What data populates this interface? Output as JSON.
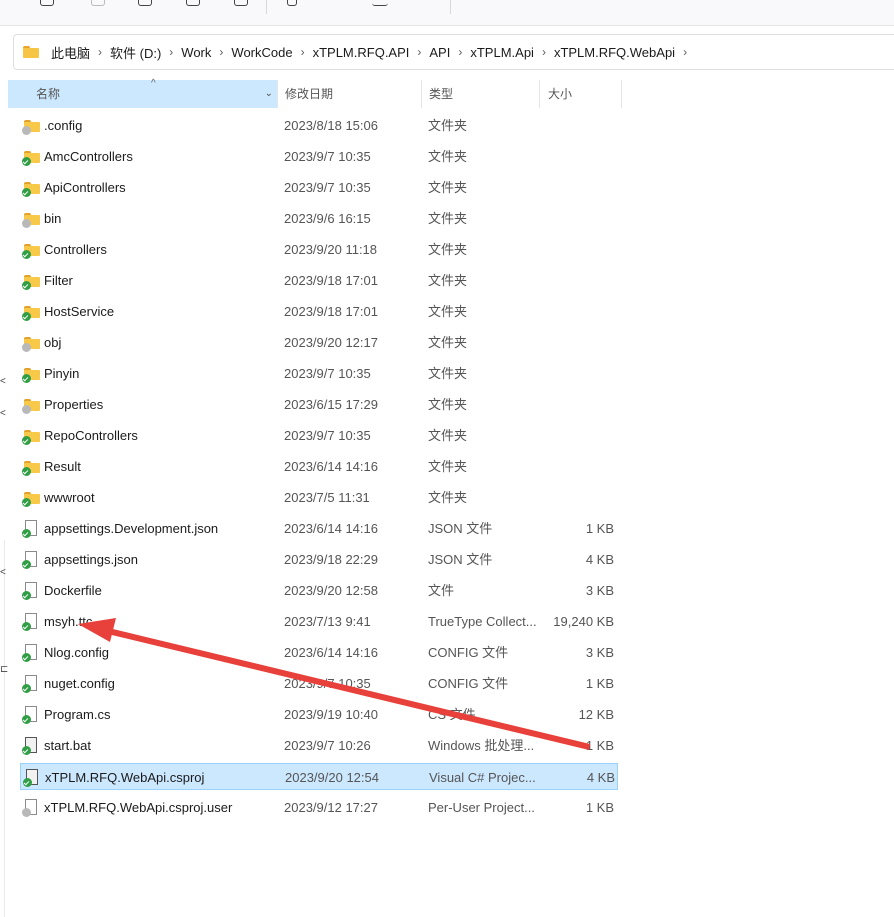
{
  "address": {
    "folder_icon": "folder-icon",
    "crumbs": [
      "此电脑",
      "软件 (D:)",
      "Work",
      "WorkCode",
      "xTPLM.RFQ.API",
      "API",
      "xTPLM.Api",
      "xTPLM.RFQ.WebApi"
    ],
    "separator": "›"
  },
  "columns": {
    "name": "名称",
    "date": "修改日期",
    "type": "类型",
    "size": "大小"
  },
  "files": [
    {
      "name": ".config",
      "date": "2023/8/18 15:06",
      "type": "文件夹",
      "size": "",
      "icon": "folder",
      "sync": "grey"
    },
    {
      "name": "AmcControllers",
      "date": "2023/9/7 10:35",
      "type": "文件夹",
      "size": "",
      "icon": "folder",
      "sync": "green"
    },
    {
      "name": "ApiControllers",
      "date": "2023/9/7 10:35",
      "type": "文件夹",
      "size": "",
      "icon": "folder",
      "sync": "green"
    },
    {
      "name": "bin",
      "date": "2023/9/6 16:15",
      "type": "文件夹",
      "size": "",
      "icon": "folder",
      "sync": "grey"
    },
    {
      "name": "Controllers",
      "date": "2023/9/20 11:18",
      "type": "文件夹",
      "size": "",
      "icon": "folder",
      "sync": "green"
    },
    {
      "name": "Filter",
      "date": "2023/9/18 17:01",
      "type": "文件夹",
      "size": "",
      "icon": "folder",
      "sync": "green"
    },
    {
      "name": "HostService",
      "date": "2023/9/18 17:01",
      "type": "文件夹",
      "size": "",
      "icon": "folder",
      "sync": "green"
    },
    {
      "name": "obj",
      "date": "2023/9/20 12:17",
      "type": "文件夹",
      "size": "",
      "icon": "folder",
      "sync": "grey"
    },
    {
      "name": "Pinyin",
      "date": "2023/9/7 10:35",
      "type": "文件夹",
      "size": "",
      "icon": "folder",
      "sync": "green"
    },
    {
      "name": "Properties",
      "date": "2023/6/15 17:29",
      "type": "文件夹",
      "size": "",
      "icon": "folder",
      "sync": "grey"
    },
    {
      "name": "RepoControllers",
      "date": "2023/9/7 10:35",
      "type": "文件夹",
      "size": "",
      "icon": "folder",
      "sync": "green"
    },
    {
      "name": "Result",
      "date": "2023/6/14 14:16",
      "type": "文件夹",
      "size": "",
      "icon": "folder",
      "sync": "green"
    },
    {
      "name": "wwwroot",
      "date": "2023/7/5 11:31",
      "type": "文件夹",
      "size": "",
      "icon": "folder",
      "sync": "green"
    },
    {
      "name": "appsettings.Development.json",
      "date": "2023/6/14 14:16",
      "type": "JSON 文件",
      "size": "1 KB",
      "icon": "file",
      "sync": "green"
    },
    {
      "name": "appsettings.json",
      "date": "2023/9/18 22:29",
      "type": "JSON 文件",
      "size": "4 KB",
      "icon": "file",
      "sync": "green"
    },
    {
      "name": "Dockerfile",
      "date": "2023/9/20 12:58",
      "type": "文件",
      "size": "3 KB",
      "icon": "file",
      "sync": "green"
    },
    {
      "name": "msyh.ttc",
      "date": "2023/7/13 9:41",
      "type": "TrueType Collect...",
      "size": "19,240 KB",
      "icon": "file",
      "sync": "green"
    },
    {
      "name": "Nlog.config",
      "date": "2023/6/14 14:16",
      "type": "CONFIG 文件",
      "size": "3 KB",
      "icon": "file",
      "sync": "green"
    },
    {
      "name": "nuget.config",
      "date": "2023/9/7 10:35",
      "type": "CONFIG 文件",
      "size": "1 KB",
      "icon": "file",
      "sync": "green"
    },
    {
      "name": "Program.cs",
      "date": "2023/9/19 10:40",
      "type": "CS 文件",
      "size": "12 KB",
      "icon": "file",
      "sync": "green"
    },
    {
      "name": "start.bat",
      "date": "2023/9/7 10:26",
      "type": "Windows 批处理...",
      "size": "1 KB",
      "icon": "file-dark",
      "sync": "green"
    },
    {
      "name": "xTPLM.RFQ.WebApi.csproj",
      "date": "2023/9/20 12:54",
      "type": "Visual C# Projec...",
      "size": "4 KB",
      "icon": "file-dark",
      "sync": "green",
      "selected": true
    },
    {
      "name": "xTPLM.RFQ.WebApi.csproj.user",
      "date": "2023/9/12 17:27",
      "type": "Per-User Project...",
      "size": "1 KB",
      "icon": "file",
      "sync": "grey"
    }
  ],
  "colors": {
    "selection": "#cce8ff",
    "selection_border": "#99d1ff",
    "annotation_arrow": "#e8403a",
    "folder": "#f8c849",
    "sync_ok": "#2f9e44"
  }
}
